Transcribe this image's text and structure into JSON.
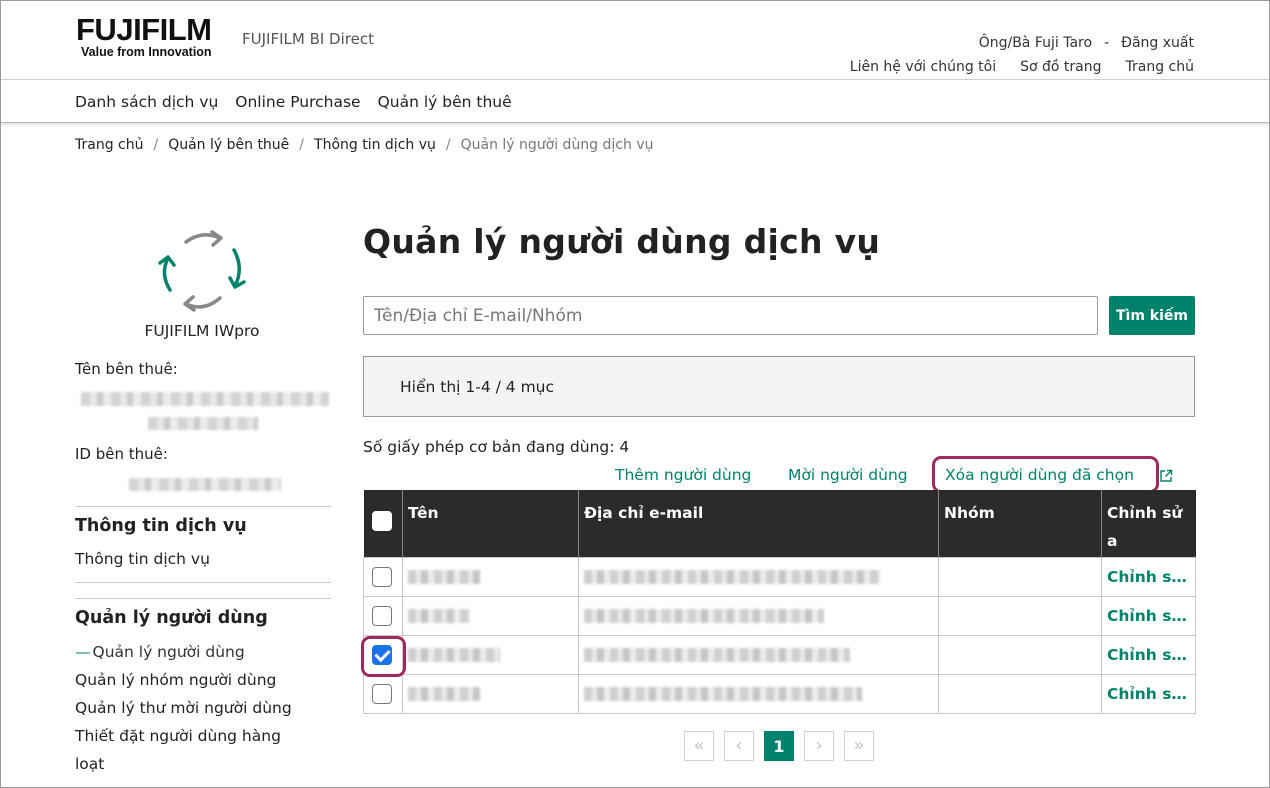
{
  "header": {
    "logo_text": "FUJIFILM",
    "logo_tagline": "Value from Innovation",
    "brand_sub": "FUJIFILM BI Direct",
    "user_name": "Ông/Bà Fuji Taro",
    "user_sep": "-",
    "logout": "Đăng xuất",
    "links": [
      "Liên hệ với chúng tôi",
      "Sơ đồ trang",
      "Trang chủ"
    ]
  },
  "nav": {
    "items": [
      "Danh sách dịch vụ",
      "Online Purchase",
      "Quản lý bên thuê"
    ]
  },
  "breadcrumb": {
    "items": [
      "Trang chủ",
      "Quản lý bên thuê",
      "Thông tin dịch vụ"
    ],
    "current": "Quản lý người dùng dịch vụ",
    "sep": "/"
  },
  "sidebar": {
    "app_name": "FUJIFILM IWpro",
    "tenant_name_label": "Tên bên thuê:",
    "tenant_id_label": "ID bên thuê:",
    "section1_title": "Thông tin dịch vụ",
    "section1_items": [
      "Thông tin dịch vụ"
    ],
    "section2_title": "Quản lý người dùng",
    "section2_active": "Quản lý người dùng",
    "section2_items": [
      "Quản lý nhóm người dùng",
      "Quản lý thư mời người dùng",
      "Thiết đặt người dùng hàng",
      "loạt"
    ],
    "colors": {
      "accent": "#00836a",
      "arrow_gray": "#888888"
    }
  },
  "main": {
    "title": "Quản lý người dùng dịch vụ",
    "search_placeholder": "Tên/Địa chỉ E-mail/Nhóm",
    "search_button": "Tìm kiếm",
    "result_text": "Hiển thị 1-4 / 4 mục",
    "license_text": "Số giấy phép cơ bản đang dùng: 4",
    "actions": {
      "add": "Thêm người dùng",
      "invite": "Mời người dùng",
      "delete": "Xóa người dùng đã chọn"
    },
    "table": {
      "headers": [
        "Tên",
        "Địa chỉ e-mail",
        "Nhóm",
        "Chỉnh sử",
        "a"
      ],
      "rows": [
        {
          "checked": false,
          "edit": "Chỉnh sửa"
        },
        {
          "checked": false,
          "edit": "Chỉnh sửa"
        },
        {
          "checked": true,
          "edit": "Chỉnh sửa"
        },
        {
          "checked": false,
          "edit": "Chỉnh sửa"
        }
      ]
    },
    "pagination": {
      "first": "«",
      "prev": "‹",
      "current": "1",
      "next": "›",
      "last": "»"
    },
    "colors": {
      "primary": "#00836a",
      "highlight": "#9c2a5f",
      "checkbox_checked": "#1a73e8"
    }
  }
}
